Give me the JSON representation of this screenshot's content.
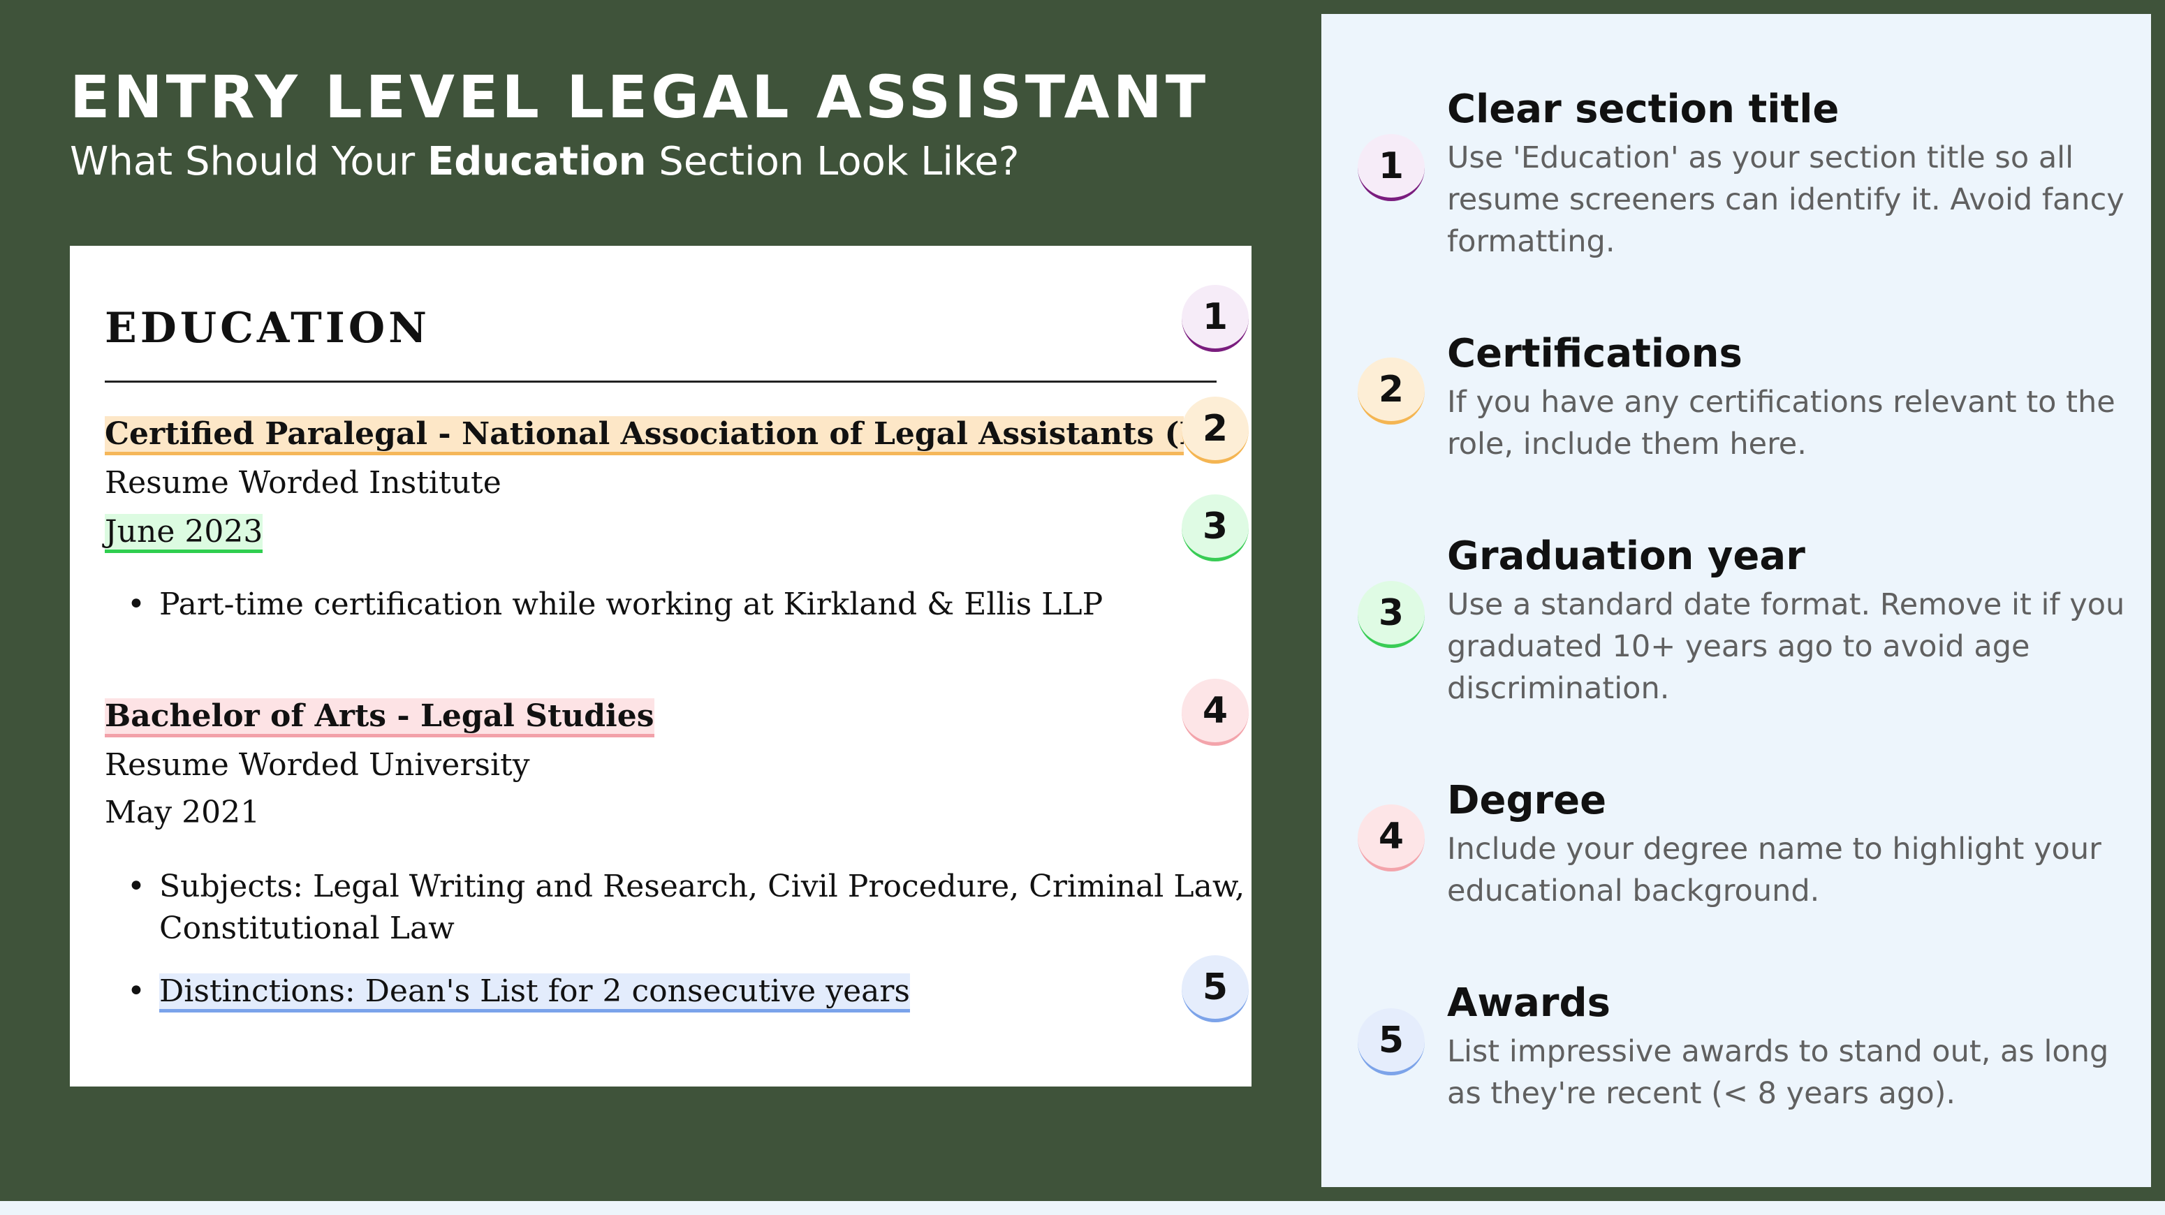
{
  "header": {
    "title": "ENTRY LEVEL LEGAL ASSISTANT",
    "subtitle_before": "What Should Your ",
    "subtitle_bold": "Education",
    "subtitle_after": " Section Look Like?"
  },
  "resume": {
    "section_title": "EDUCATION",
    "entries": [
      {
        "title": "Certified Paralegal - National Association of Legal Assistants (NALA)",
        "institution": "Resume Worded Institute",
        "date": "June 2023",
        "bullets": [
          "Part-time certification while working at Kirkland & Ellis LLP"
        ]
      },
      {
        "title": "Bachelor of Arts - Legal Studies",
        "institution": "Resume Worded University",
        "date": "May 2021",
        "bullets": [
          "Subjects: Legal Writing and Research, Civil Procedure, Criminal Law,",
          "Constitutional Law",
          "Distinctions: Dean's List for 2 consecutive years"
        ]
      }
    ],
    "badges": [
      "1",
      "2",
      "3",
      "4",
      "5"
    ]
  },
  "tips": [
    {
      "number": "1",
      "title": "Clear section title",
      "lines": [
        "Use 'Education' as your section title so all",
        "resume screeners can identify it. Avoid fancy",
        "formatting."
      ]
    },
    {
      "number": "2",
      "title": "Certifications",
      "lines": [
        "If you have any certifications relevant to the",
        "role, include them here."
      ]
    },
    {
      "number": "3",
      "title": "Graduation year",
      "lines": [
        "Use a standard date format. Remove it if you",
        "graduated 10+ years ago to avoid age",
        "discrimination."
      ]
    },
    {
      "number": "4",
      "title": "Degree",
      "lines": [
        "Include your degree name to highlight your",
        "educational background."
      ]
    },
    {
      "number": "5",
      "title": "Awards",
      "lines": [
        "List impressive awards to stand out, as long",
        "as they're recent (< 8 years ago)."
      ]
    }
  ],
  "colors": {
    "background": "#3f533a",
    "panel": "#edf5fc",
    "badge_1": "#7a1d7e",
    "badge_2": "#f4b552",
    "badge_3": "#39cc55",
    "badge_4": "#f3a4ab",
    "badge_5": "#7ca3e9"
  }
}
